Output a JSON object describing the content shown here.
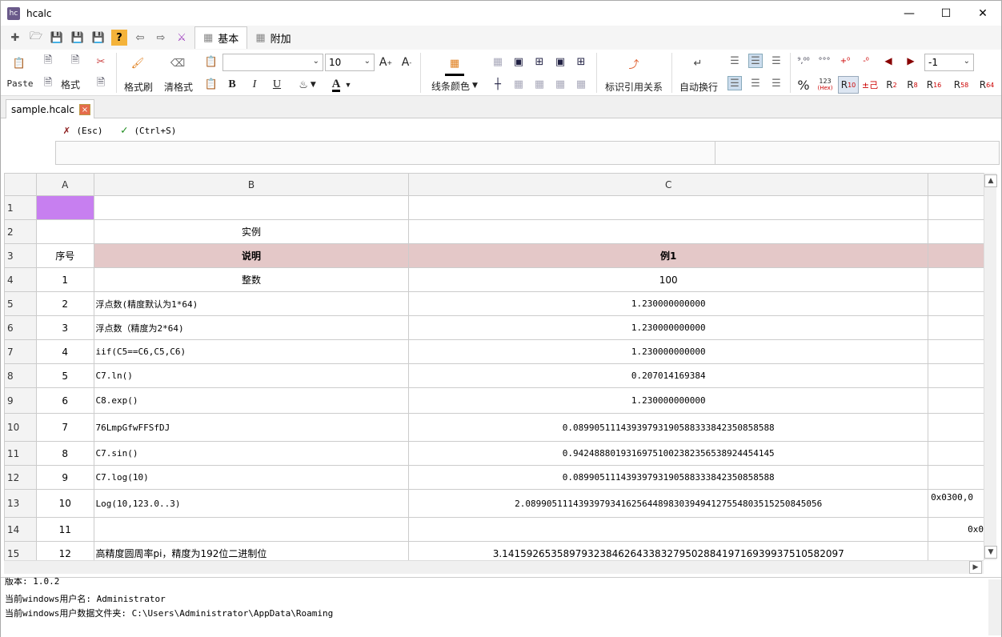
{
  "window": {
    "title": "hcalc",
    "icon_label": "hc"
  },
  "tabs": {
    "basic": "基本",
    "extra": "附加"
  },
  "ribbon": {
    "paste": "Paste",
    "format": "格式",
    "format_painter": "格式刷",
    "clear_format": "清格式",
    "font_size": "10",
    "bold": "B",
    "italic": "I",
    "underline": "U",
    "font_color": "A",
    "line_color": "线条颜色",
    "trace_refs": "标识引用关系",
    "wrap_text": "自动换行",
    "decimal_select": "-1",
    "percent": "%",
    "num_123": "123",
    "num_hex": "(Hex)",
    "r10": "R",
    "r10_sup": "10",
    "r_dec": "±己",
    "r2": "R",
    "r2_sup": "2",
    "r8": "R",
    "r8_sup": "8",
    "r16": "R",
    "r16_sup": "16",
    "r58": "R",
    "r58_sup": "58",
    "r64": "R",
    "r64_sup": "64"
  },
  "file_tab": {
    "name": "sample.hcalc",
    "close": "×"
  },
  "editbar": {
    "cancel": "(Esc)",
    "confirm": "(Ctrl+S)"
  },
  "grid": {
    "columns": [
      "A",
      "B",
      "C"
    ],
    "rows": [
      {
        "n": "1",
        "a": "",
        "b": "",
        "c": "",
        "d": ""
      },
      {
        "n": "2",
        "a": "",
        "b": "实例",
        "c": "",
        "d": ""
      },
      {
        "n": "3",
        "a": "序号",
        "b": "说明",
        "c": "例1",
        "d": ""
      },
      {
        "n": "4",
        "a": "1",
        "b": "整数",
        "c": "100",
        "d": ""
      },
      {
        "n": "5",
        "a": "2",
        "b": "浮点数(精度默认为1*64)",
        "c": "1.230000000000",
        "d": ""
      },
      {
        "n": "6",
        "a": "3",
        "b": "浮点数（精度为2*64)",
        "c": "1.230000000000",
        "d": ""
      },
      {
        "n": "7",
        "a": "4",
        "b": "iif(C5==C6,C5,C6)",
        "c": "1.230000000000",
        "d": ""
      },
      {
        "n": "8",
        "a": "5",
        "b": "C7.ln()",
        "c": "0.207014169384",
        "d": ""
      },
      {
        "n": "9",
        "a": "6",
        "b": "C8.exp()",
        "c": "1.230000000000",
        "d": ""
      },
      {
        "n": "10",
        "a": "7",
        "b": "76LmpGfwFFSfDJ",
        "c": "0.08990511143939793190588333842350858588",
        "d": ""
      },
      {
        "n": "11",
        "a": "8",
        "b": "C7.sin()",
        "c": "0.94248880193169751002382356538924454145",
        "d": ""
      },
      {
        "n": "12",
        "a": "9",
        "b": "C7.log(10)",
        "c": "0.08990511143939793190588333842350858588",
        "d": ""
      },
      {
        "n": "13",
        "a": "10",
        "b": "Log(10,123.0..3)",
        "c": "2.08990511143939793416256448983039494127554803515250845056",
        "d": "0x0300,0"
      },
      {
        "n": "14",
        "a": "11",
        "b": "",
        "c": "",
        "d": "0x0"
      },
      {
        "n": "15",
        "a": "12",
        "b": "高精度圆周率pi，精度为192位二进制位",
        "c": "3.14159265358979323846264338327950288419716939937510582097",
        "d": ""
      }
    ]
  },
  "log": {
    "line1": "版本: 1.0.2",
    "line2": "当前windows用户名: Administrator",
    "line3": "当前windows用户数据文件夹: C:\\Users\\Administrator\\AppData\\Roaming"
  }
}
